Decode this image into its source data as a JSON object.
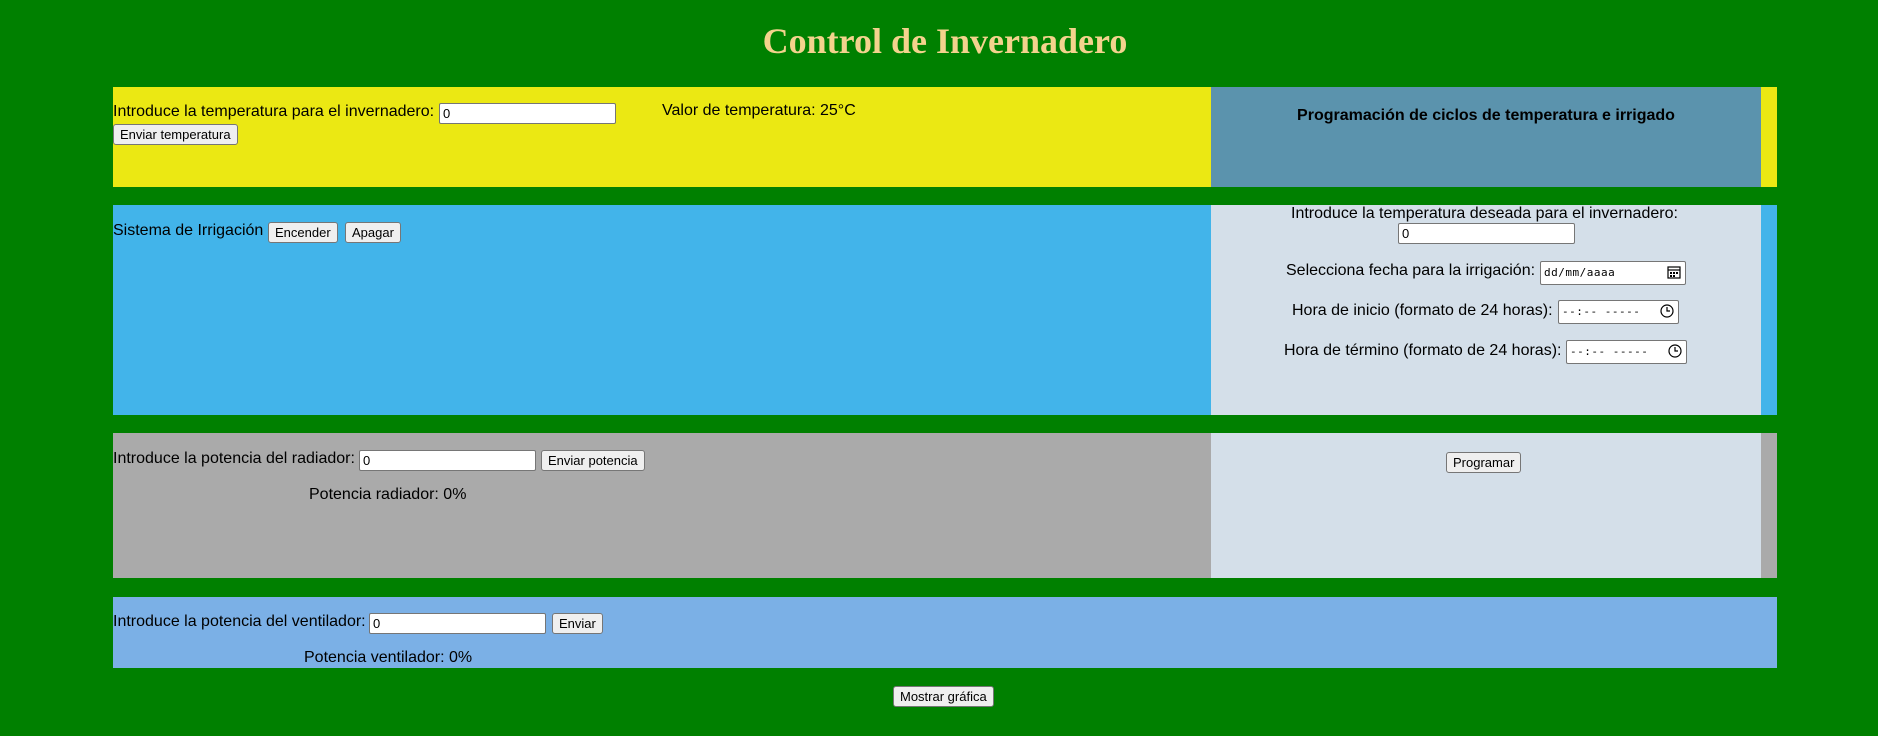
{
  "page": {
    "title": "Control de Invernadero"
  },
  "temperature": {
    "label": "Introduce la temperatura para el invernadero:",
    "input_value": "0",
    "button": "Enviar temperatura",
    "value_text": "Valor de temperatura: 25°C"
  },
  "schedule": {
    "heading": "Programación de ciclos de temperatura e irrigado",
    "temp_label": "Introduce la temperatura deseada para el invernadero:",
    "temp_value": "0",
    "date_label": "Selecciona fecha para la irrigación:",
    "date_placeholder": "dd/mm/aaaa",
    "start_label": "Hora de inicio (formato de 24 horas):",
    "start_placeholder": "--:-- -----",
    "end_label": "Hora de término (formato de 24 horas):",
    "end_placeholder": "--:-- -----",
    "program_button": "Programar"
  },
  "irrigation": {
    "label": "Sistema de Irrigación",
    "on_button": "Encender",
    "off_button": "Apagar"
  },
  "radiator": {
    "label": "Introduce la potencia del radiador:",
    "input_value": "0",
    "button": "Enviar potencia",
    "status": "Potencia radiador: 0%"
  },
  "fan": {
    "label": "Introduce la potencia del ventilador:",
    "input_value": "0",
    "button": "Enviar",
    "status": "Potencia ventilador: 0%"
  },
  "footer": {
    "chart_button": "Mostrar gráfica"
  },
  "icons": {
    "date": "calendar-icon",
    "time": "clock-icon"
  },
  "colors": {
    "background": "#008000",
    "title": "#f3d38d",
    "band_temperature": "#ebe813",
    "panel_schedule_header": "#5b93ad",
    "band_irrigation": "#42b4ea",
    "panel_schedule_body": "#d4dfe9",
    "band_radiator": "#aaaaaa",
    "band_fan": "#7bb0e6"
  }
}
